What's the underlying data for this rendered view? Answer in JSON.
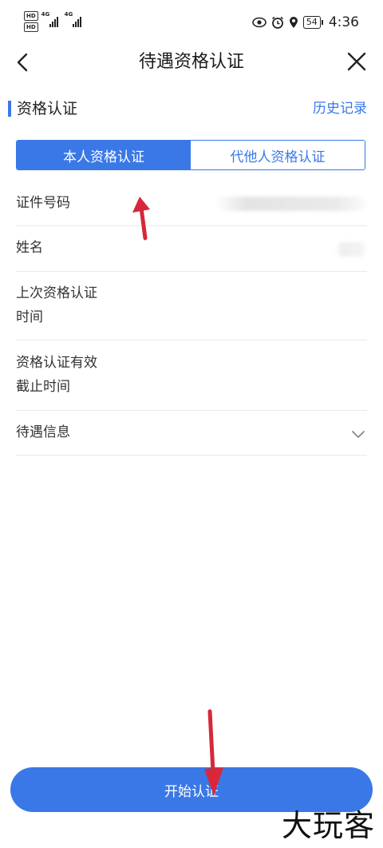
{
  "status_bar": {
    "hd_badges": [
      "HD",
      "HD"
    ],
    "signal_labels": [
      "4G",
      "4G"
    ],
    "battery": "54",
    "time": "4:36"
  },
  "header": {
    "title": "待遇资格认证"
  },
  "section": {
    "title": "资格认证",
    "history_link": "历史记录"
  },
  "tabs": [
    {
      "label": "本人资格认证",
      "active": true
    },
    {
      "label": "代他人资格认证",
      "active": false
    }
  ],
  "form": {
    "id_number_label": "证件号码",
    "name_label": "姓名",
    "last_cert_time_label_line1": "上次资格认证",
    "last_cert_time_label_line2": "时间",
    "valid_until_label_line1": "资格认证有效",
    "valid_until_label_line2": "截止时间",
    "benefit_info_label": "待遇信息"
  },
  "button": {
    "start_label": "开始认证"
  },
  "watermark": "大玩客",
  "colors": {
    "accent": "#3b78e7",
    "annotation_arrow": "#d6283a"
  }
}
